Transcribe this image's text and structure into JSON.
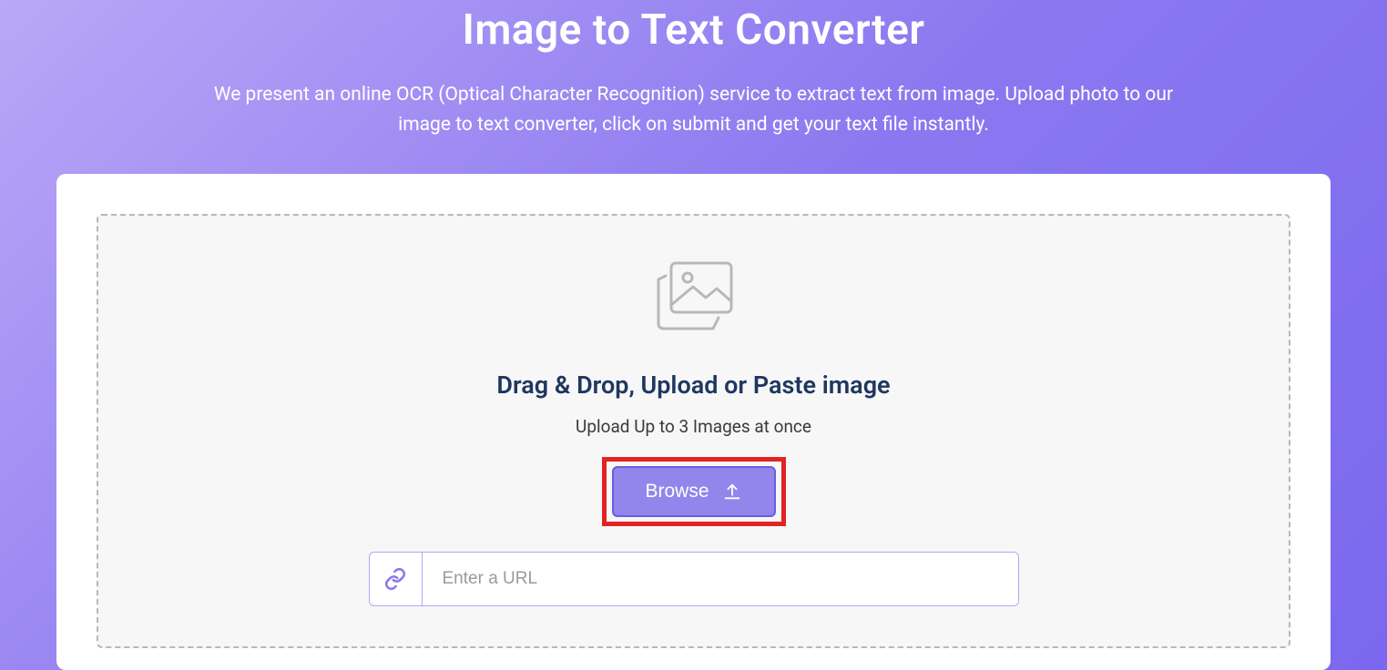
{
  "header": {
    "title": "Image to Text Converter",
    "subtitle": "We present an online OCR (Optical Character Recognition) service to extract text from image. Upload photo to our image to text converter, click on submit and get your text file instantly."
  },
  "dropzone": {
    "heading": "Drag & Drop, Upload or Paste image",
    "sub": "Upload Up to 3 Images at once",
    "browse_label": "Browse",
    "url_placeholder": "Enter a URL"
  }
}
